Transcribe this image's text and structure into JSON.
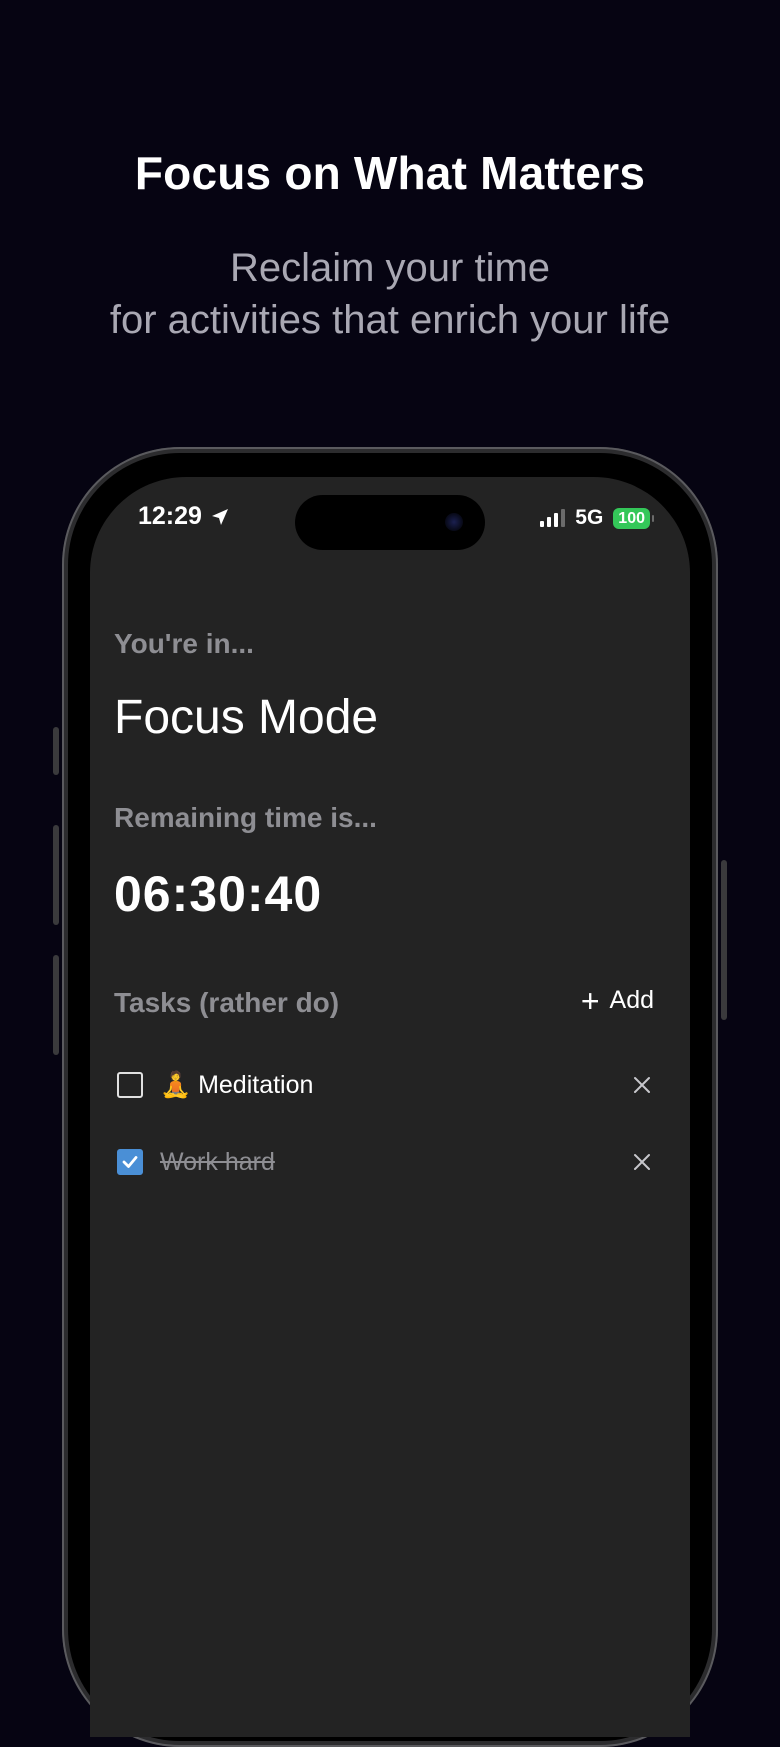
{
  "promo": {
    "title": "Focus on What Matters",
    "subtitle_line1": "Reclaim your time",
    "subtitle_line2": "for activities that enrich your life"
  },
  "status_bar": {
    "time": "12:29",
    "network": "5G",
    "battery": "100"
  },
  "screen": {
    "mode_label": "You're in...",
    "mode_name": "Focus Mode",
    "remaining_label": "Remaining time is...",
    "remaining_time": "06:30:40",
    "tasks_label": "Tasks (rather do)",
    "add_label": "Add"
  },
  "tasks": [
    {
      "text": "🧘 Meditation",
      "checked": false
    },
    {
      "text": "Work hard",
      "checked": true
    }
  ],
  "colors": {
    "background": "#060412",
    "screen": "#232323",
    "checkbox_checked": "#4a8fd6",
    "battery": "#34c759"
  }
}
